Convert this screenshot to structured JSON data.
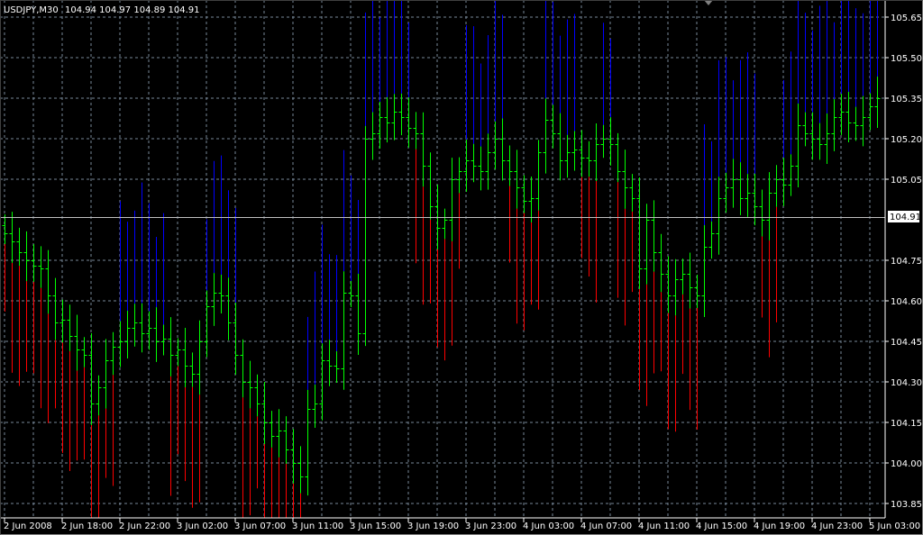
{
  "header": {
    "symbol": "USDJPY,M30",
    "ohlc": "104.94 104.97 104.89 104.91"
  },
  "chart_data": {
    "type": "ohlc-bar",
    "symbol": "USDJPY",
    "timeframe": "M30",
    "bid": 104.91,
    "bid_label": "104.91",
    "ylim": [
      103.8,
      105.7
    ],
    "grid": true,
    "price_ticks": [
      "105.65",
      "105.50",
      "105.35",
      "105.20",
      "105.05",
      "104.75",
      "104.60",
      "104.45",
      "104.30",
      "104.15",
      "104.00",
      "103.85"
    ],
    "price_tick_values": [
      105.65,
      105.5,
      105.35,
      105.2,
      105.05,
      104.75,
      104.6,
      104.45,
      104.3,
      104.15,
      104.0,
      103.85
    ],
    "time_ticks": [
      "2 Jun 2008",
      "2 Jun 18:00",
      "2 Jun 22:00",
      "3 Jun 02:00",
      "3 Jun 07:00",
      "3 Jun 11:00",
      "3 Jun 15:00",
      "3 Jun 19:00",
      "3 Jun 23:00",
      "4 Jun 03:00",
      "4 Jun 07:00",
      "4 Jun 11:00",
      "4 Jun 15:00",
      "4 Jun 19:00",
      "4 Jun 23:00",
      "5 Jun 03:00"
    ],
    "colors": {
      "background": "#000000",
      "grid": "#778899",
      "axis": "#ffffff",
      "bar": "#00ff00",
      "upper": "#0000ff",
      "lower": "#ff0000",
      "bid_line": "#c0c0c0"
    },
    "close": [
      104.85,
      104.82,
      104.78,
      104.75,
      104.73,
      104.72,
      104.62,
      104.52,
      104.53,
      104.47,
      104.42,
      104.4,
      104.22,
      104.28,
      104.38,
      104.43,
      104.45,
      104.5,
      104.52,
      104.48,
      104.5,
      104.45,
      104.46,
      104.4,
      104.42,
      104.36,
      104.33,
      104.45,
      104.58,
      104.63,
      104.62,
      104.52,
      104.4,
      104.3,
      104.28,
      104.22,
      104.15,
      104.1,
      104.12,
      104.05,
      104.0,
      103.95,
      104.2,
      104.22,
      104.38,
      104.36,
      104.35,
      104.63,
      104.62,
      104.48,
      105.2,
      105.22,
      105.28,
      105.26,
      105.3,
      105.28,
      105.24,
      105.22,
      105.1,
      104.95,
      104.87,
      104.9,
      105.05,
      105.08,
      105.12,
      105.1,
      105.08,
      105.15,
      105.2,
      105.12,
      105.08,
      105.02,
      104.97,
      104.98,
      105.15,
      105.27,
      105.22,
      105.12,
      105.15,
      105.16,
      105.13,
      105.12,
      105.18,
      105.2,
      105.18,
      105.08,
      105.02,
      104.98,
      104.72,
      104.9,
      104.78,
      104.7,
      104.62,
      104.68,
      104.7,
      104.65,
      104.62,
      104.8,
      104.85,
      104.98,
      105.02,
      105.05,
      104.98,
      105.0,
      104.95,
      104.9,
      105.0,
      105.05,
      105.03,
      105.1,
      105.25,
      105.22,
      105.2,
      105.18,
      105.22,
      105.28,
      105.3,
      105.26,
      105.25,
      105.28,
      105.32,
      105.35
    ]
  }
}
